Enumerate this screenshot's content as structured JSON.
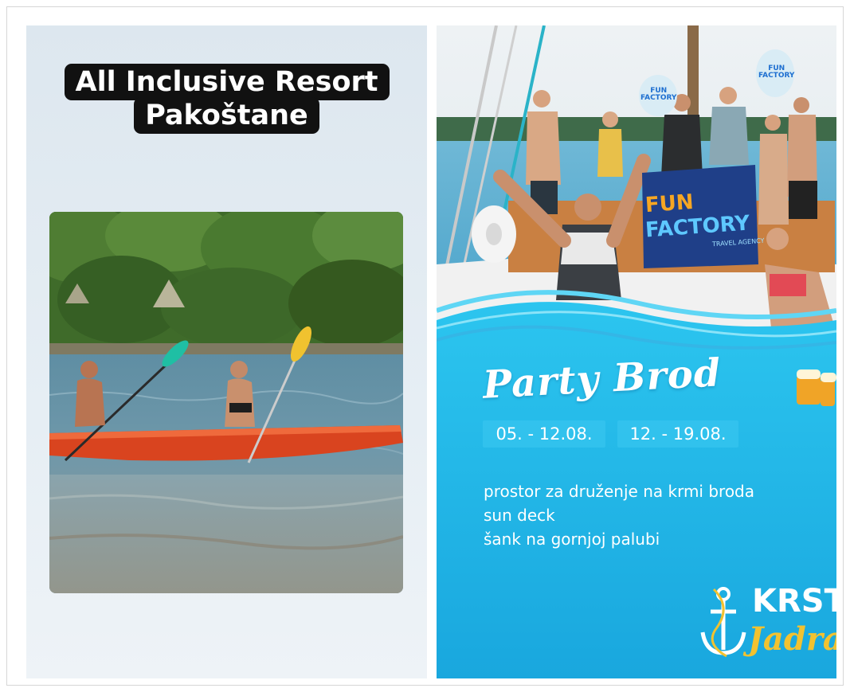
{
  "left_panel": {
    "title_line_1": "All Inclusive Resort",
    "title_line_2": "Pakoštane",
    "photo_icon": "kayak-photo"
  },
  "right_panel": {
    "photo_icon": "party-boat-photo",
    "banner": {
      "line_1": "FUN",
      "line_2": "FACTORY",
      "sub": "TRAVEL AGENCY"
    },
    "paddle_sign": {
      "line_1": "FUN",
      "line_2": "FACTORY"
    },
    "title": "Party Brod",
    "dates": [
      "05. - 12.08.",
      "12. - 19.08."
    ],
    "features": [
      "prostor za druženje na krmi broda",
      "sun deck",
      "šank na gornjoj palubi"
    ],
    "logo": {
      "line_1": "KRSTA",
      "line_2": "Jadra",
      "icon": "anchor-icon"
    },
    "beer_icon": "beer-mugs-icon"
  },
  "colors": {
    "left_bg": "#e3ecf2",
    "title_bg": "#111111",
    "party_blue": "#1fb1e0",
    "logo_gold": "#f2c230"
  }
}
